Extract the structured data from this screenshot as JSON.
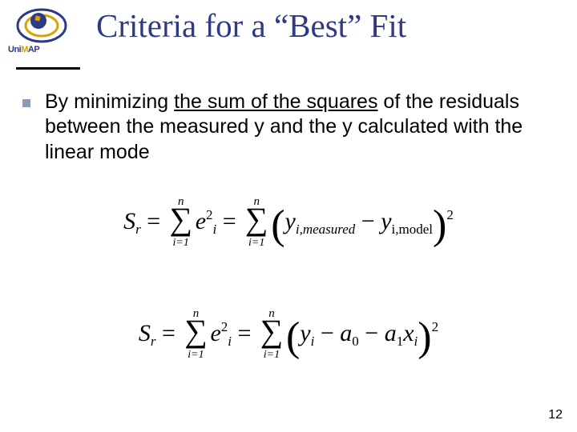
{
  "title": "Criteria for a “Best” Fit",
  "logo": {
    "uni": "Uni",
    "m": "M",
    "ap": "AP"
  },
  "body": {
    "pre": "By minimizing ",
    "underlined": "the sum of the squares",
    "post": " of the residuals between the measured y and the y calculated with the linear mode"
  },
  "eq_shared": {
    "Sr": "S",
    "r": "r",
    "eq": " = ",
    "sum_top": "n",
    "sum_bot": "i=1",
    "e": "e",
    "two": "2",
    "i": "i",
    "y": "y"
  },
  "eq1": {
    "meas": "i,measured",
    "minus": " − ",
    "model": "i,model"
  },
  "eq2": {
    "minus": " − ",
    "a": "a",
    "zero": "0",
    "one": "1",
    "x": "x",
    "isub": "i"
  },
  "page_number": "12"
}
